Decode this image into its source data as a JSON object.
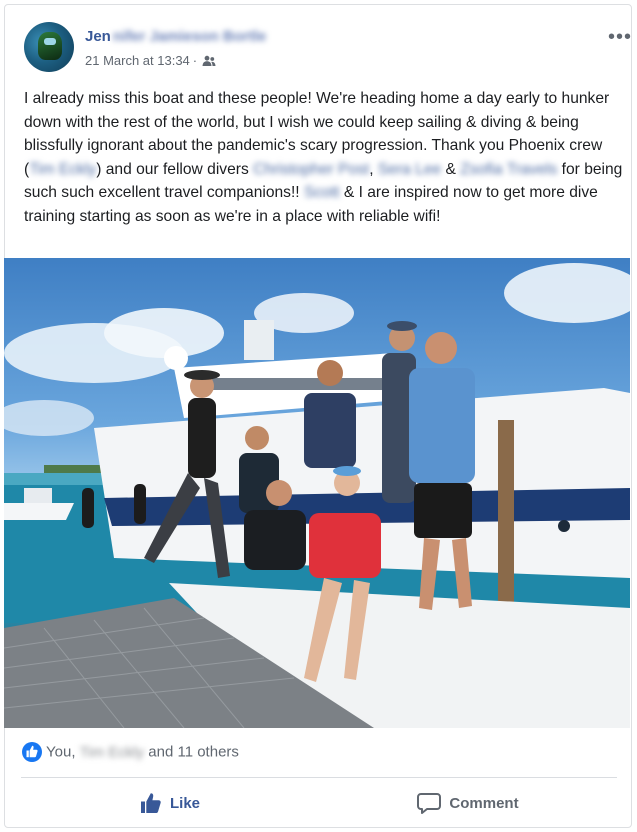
{
  "post": {
    "author_visible": "Jen",
    "author_blurred": "nifer Jamieson Bortle",
    "timestamp": "21 March at 13:34",
    "separator": "·",
    "text": {
      "p1": "I already miss this boat and these people! We're heading home a day early to hunker down with the rest of the world, but I wish we could keep sailing & diving & being blissfully ignorant about the pandemic's scary progression. Thank you Phoenix crew (",
      "tag1": "Tim Eckly",
      "p2": ") and our fellow divers ",
      "tag2": "Christopher Post",
      "p3": ", ",
      "tag3": "Sera Lee",
      "p4": " & ",
      "tag4": "Zsofia Travels",
      "p5": " for being such such excellent travel companions!! ",
      "tag5": "Scott",
      "p6": " & I are inspired now to get more dive training starting as soon as we're in a place with reliable wifi!"
    }
  },
  "reactions": {
    "you": "You,",
    "blurred_name": "Tim Eckly",
    "others": "and 11 others"
  },
  "actions": {
    "like": "Like",
    "comment": "Comment"
  },
  "icons": {
    "audience": "friends-icon",
    "more": "more-options-icon",
    "like": "thumbs-up-icon",
    "comment": "comment-bubble-icon"
  },
  "colors": {
    "link": "#385898",
    "brand": "#1877f2",
    "secondary_text": "#606770"
  }
}
